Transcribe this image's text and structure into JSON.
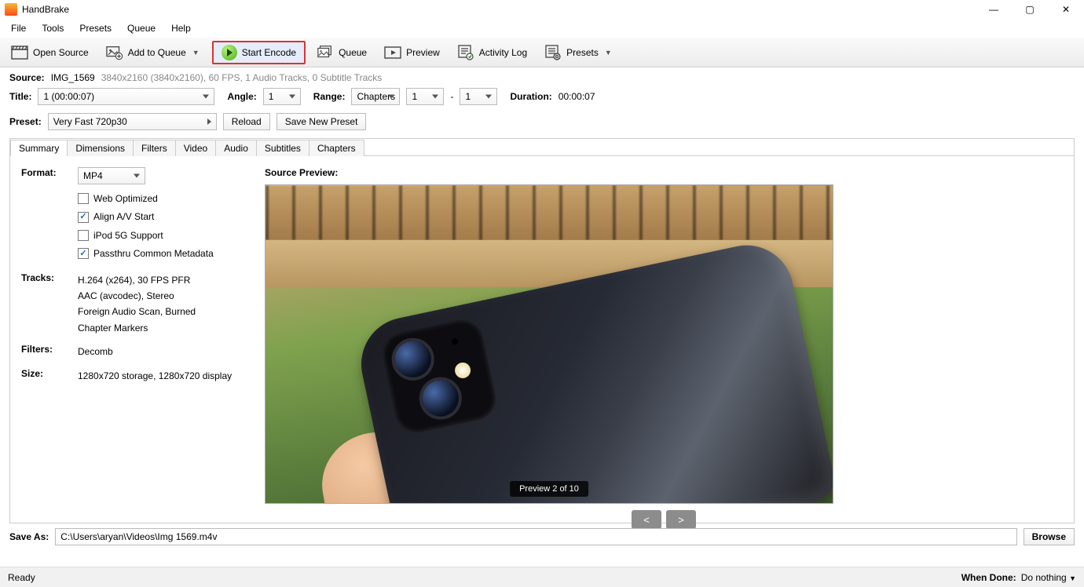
{
  "app_title": "HandBrake",
  "menu": [
    "File",
    "Tools",
    "Presets",
    "Queue",
    "Help"
  ],
  "toolbar": {
    "open_source": "Open Source",
    "add_to_queue": "Add to Queue",
    "start_encode": "Start Encode",
    "queue": "Queue",
    "preview": "Preview",
    "activity_log": "Activity Log",
    "presets": "Presets"
  },
  "source": {
    "label": "Source:",
    "name": "IMG_1569",
    "details": "3840x2160 (3840x2160), 60 FPS, 1 Audio Tracks, 0 Subtitle Tracks"
  },
  "title_row": {
    "title_label": "Title:",
    "title_value": "1   (00:00:07)",
    "angle_label": "Angle:",
    "angle_value": "1",
    "range_label": "Range:",
    "range_type": "Chapters",
    "range_from": "1",
    "range_to": "1",
    "duration_label": "Duration:",
    "duration_value": "00:00:07"
  },
  "preset": {
    "label": "Preset:",
    "value": "Very Fast 720p30",
    "reload": "Reload",
    "save_new": "Save New Preset"
  },
  "tabs": [
    "Summary",
    "Dimensions",
    "Filters",
    "Video",
    "Audio",
    "Subtitles",
    "Chapters"
  ],
  "summary": {
    "format_label": "Format:",
    "format_value": "MP4",
    "checks": {
      "web_optimized": {
        "label": "Web Optimized",
        "checked": false
      },
      "align_av": {
        "label": "Align A/V Start",
        "checked": true
      },
      "ipod": {
        "label": "iPod 5G Support",
        "checked": false
      },
      "passthru": {
        "label": "Passthru Common Metadata",
        "checked": true
      }
    },
    "tracks_label": "Tracks:",
    "tracks_lines": [
      "H.264 (x264), 30 FPS PFR",
      "AAC (avcodec), Stereo",
      "Foreign Audio Scan, Burned",
      "Chapter Markers"
    ],
    "filters_label": "Filters:",
    "filters_value": "Decomb",
    "size_label": "Size:",
    "size_value": "1280x720 storage, 1280x720 display"
  },
  "preview": {
    "title": "Source Preview:",
    "badge": "Preview 2 of 10",
    "prev": "<",
    "next": ">"
  },
  "save": {
    "label": "Save As:",
    "path": "C:\\Users\\aryan\\Videos\\Img 1569.m4v",
    "browse": "Browse"
  },
  "status": {
    "left": "Ready",
    "when_done_label": "When Done:",
    "when_done_value": "Do nothing"
  }
}
